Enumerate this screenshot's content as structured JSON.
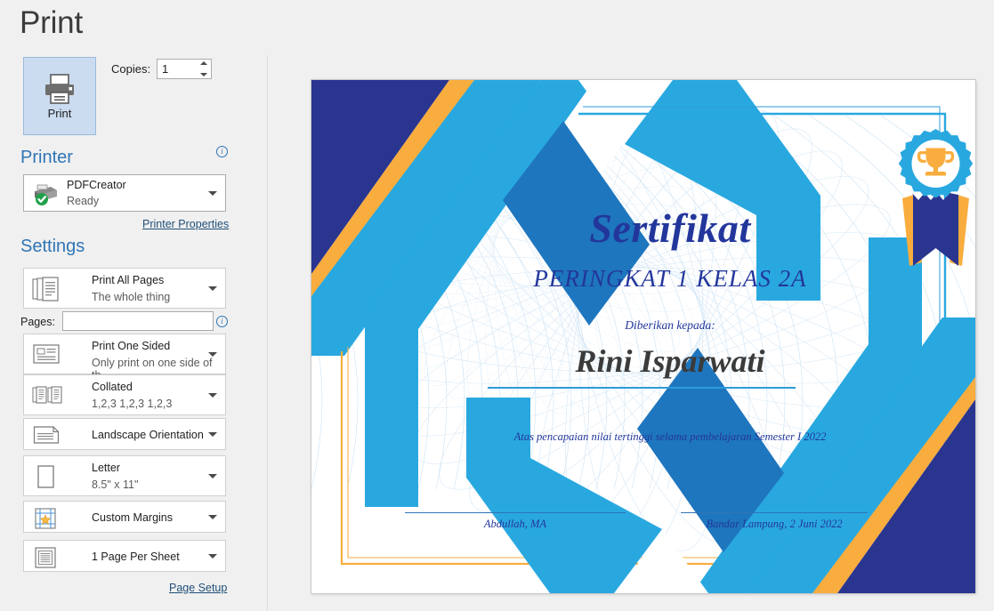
{
  "header": {
    "title": "Print"
  },
  "print_button": {
    "label": "Print",
    "icon": "printer-icon"
  },
  "copies": {
    "label": "Copies:",
    "value": "1",
    "spinner_up": "up-arrow-icon",
    "spinner_down": "down-arrow-icon"
  },
  "printer": {
    "section_label": "Printer",
    "info_icon": "info-icon",
    "name": "PDFCreator",
    "status": "Ready",
    "icon": "printer-ready-icon",
    "properties_link": "Printer Properties"
  },
  "settings": {
    "section_label": "Settings",
    "pages_label": "Pages:",
    "pages_value": "",
    "pages_placeholder": "",
    "pages_info_icon": "info-icon",
    "page_setup_link": "Page Setup",
    "rows": [
      {
        "id": "all-pages",
        "primary": "Print All Pages",
        "secondary": "The whole thing",
        "icon": "document-stack-icon"
      },
      {
        "id": "one-sided",
        "primary": "Print One Sided",
        "secondary": "Only print on one side of th...",
        "icon": "one-sided-page-icon"
      },
      {
        "id": "collated",
        "primary": "Collated",
        "secondary": "1,2,3   1,2,3   1,2,3",
        "icon": "collated-pages-icon"
      },
      {
        "id": "orientation",
        "primary": "Landscape Orientation",
        "secondary": "",
        "icon": "landscape-page-icon"
      },
      {
        "id": "paper-size",
        "primary": "Letter",
        "secondary": "8.5\" x 11\"",
        "icon": "paper-size-icon"
      },
      {
        "id": "margins",
        "primary": "Custom Margins",
        "secondary": "",
        "icon": "margins-icon"
      },
      {
        "id": "pages-per-sheet",
        "primary": "1 Page Per Sheet",
        "secondary": "",
        "icon": "pages-per-sheet-icon"
      }
    ]
  },
  "preview": {
    "certificate": {
      "title": "Sertifikat",
      "subtitle": "PERINGKAT 1 KELAS 2A",
      "given_to_label": "Diberikan kepada:",
      "recipient_name": "Rini Isparwati",
      "description": "Atas pencapaian nilai tertinggi selama pembelajaran Semester I 2022",
      "signature_left": "Abdullah, MA",
      "signature_right": "Bandar Lampung, 2 Juni 2022",
      "badge_icon": "award-trophy-medal-icon"
    },
    "colors": {
      "navy": "#2A3590",
      "orange": "#F9AD3E",
      "light_blue": "#29A8E0",
      "mid_blue": "#1E76BE",
      "text_blue": "#23369B",
      "name_gray": "#3B3B3B",
      "rule_blue": "#2E9BD8"
    }
  }
}
